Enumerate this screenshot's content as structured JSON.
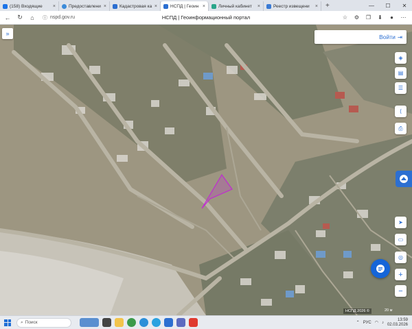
{
  "browser": {
    "tabs": [
      {
        "label": "(158) Входящие",
        "color": "#1a73e8",
        "active": false
      },
      {
        "label": "Предоставлени",
        "color": "#3c8bd9",
        "active": false
      },
      {
        "label": "Кадастровая ка",
        "color": "#2c6fd1",
        "active": false
      },
      {
        "label": "НСПД | Геоин",
        "color": "#2c6fd1",
        "active": true
      },
      {
        "label": "Личный кабинет",
        "color": "#2aa68a",
        "active": false
      },
      {
        "label": "Реестр извещени",
        "color": "#3a7bd5",
        "active": false
      }
    ],
    "url": "nspd.gov.ru",
    "page_title": "НСПД | Геоинформационный портал"
  },
  "map": {
    "login_label": "Войти",
    "attribution": "НСПД 2026 ©",
    "scale": "20 м",
    "parcel_color": "#c02bd0"
  },
  "taskbar": {
    "search_placeholder": "Поиск",
    "language": "РУС",
    "time": "13:59",
    "date": "02.03.2026"
  }
}
